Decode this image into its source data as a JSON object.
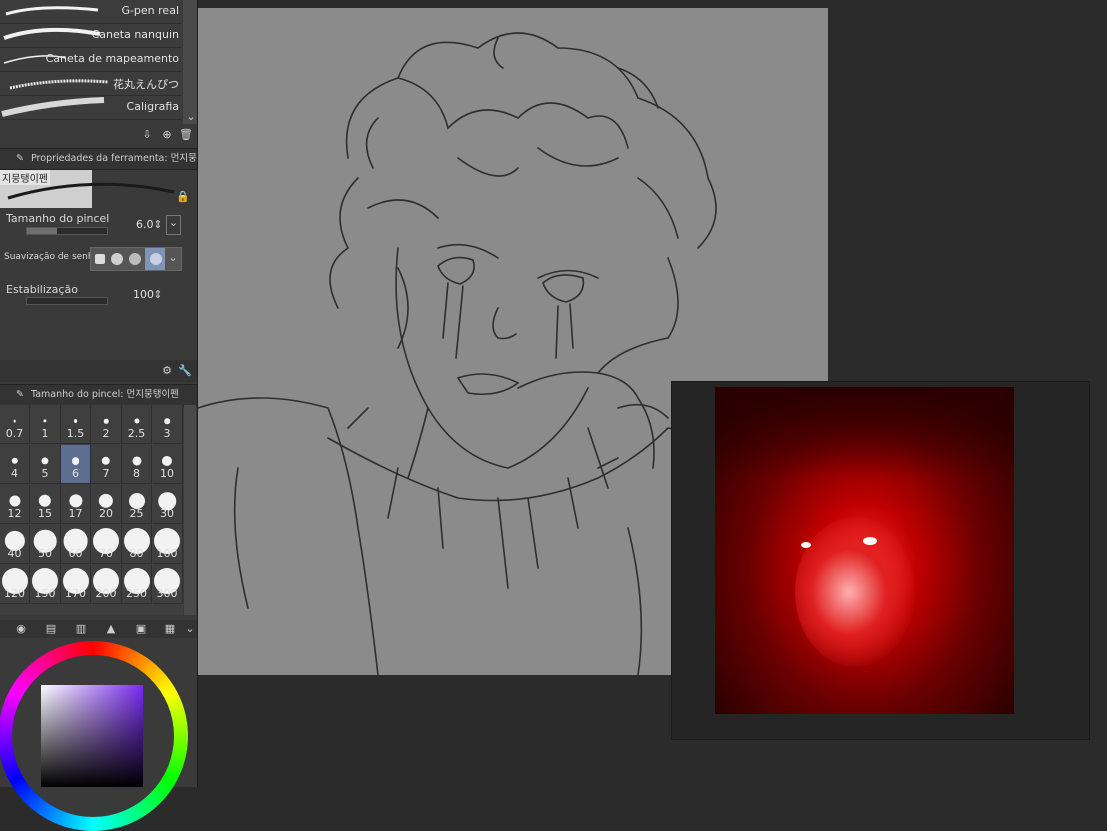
{
  "brushes": [
    {
      "label": "G-pen real"
    },
    {
      "label": "Caneta nanquin"
    },
    {
      "label": "Caneta de mapeamento"
    },
    {
      "label": "花丸えんぴつ"
    },
    {
      "label": "Caligrafia"
    }
  ],
  "tool_property": {
    "header": "Propriedades da ferramenta: 먼지뭉탱이펜",
    "brush_name": "지뭉탱이펜",
    "brush_size_label": "Tamanho do pincel",
    "brush_size_value": "6.0",
    "smoothing_label": "Suavização de senha",
    "stabilization_label": "Estabilização",
    "stabilization_value": "100"
  },
  "brush_size_panel": {
    "header": "Tamanho do pincel: 먼지뭉탱이펜",
    "sizes": [
      "0.7",
      "1",
      "1.5",
      "2",
      "2.5",
      "3",
      "4",
      "5",
      "6",
      "7",
      "8",
      "10",
      "12",
      "15",
      "17",
      "20",
      "25",
      "30",
      "40",
      "50",
      "60",
      "70",
      "80",
      "100",
      "120",
      "150",
      "170",
      "200",
      "250",
      "300"
    ],
    "selected": "6"
  },
  "colors": {
    "panel": "#3a3a3a",
    "canvas": "#8b8b8b",
    "selection": "#5b6e8f",
    "color_square": "#7a2cf0"
  },
  "icons": [
    "export-icon",
    "duplicate-icon",
    "trash-icon",
    "lock-icon",
    "settings-icon",
    "wrench-icon"
  ]
}
